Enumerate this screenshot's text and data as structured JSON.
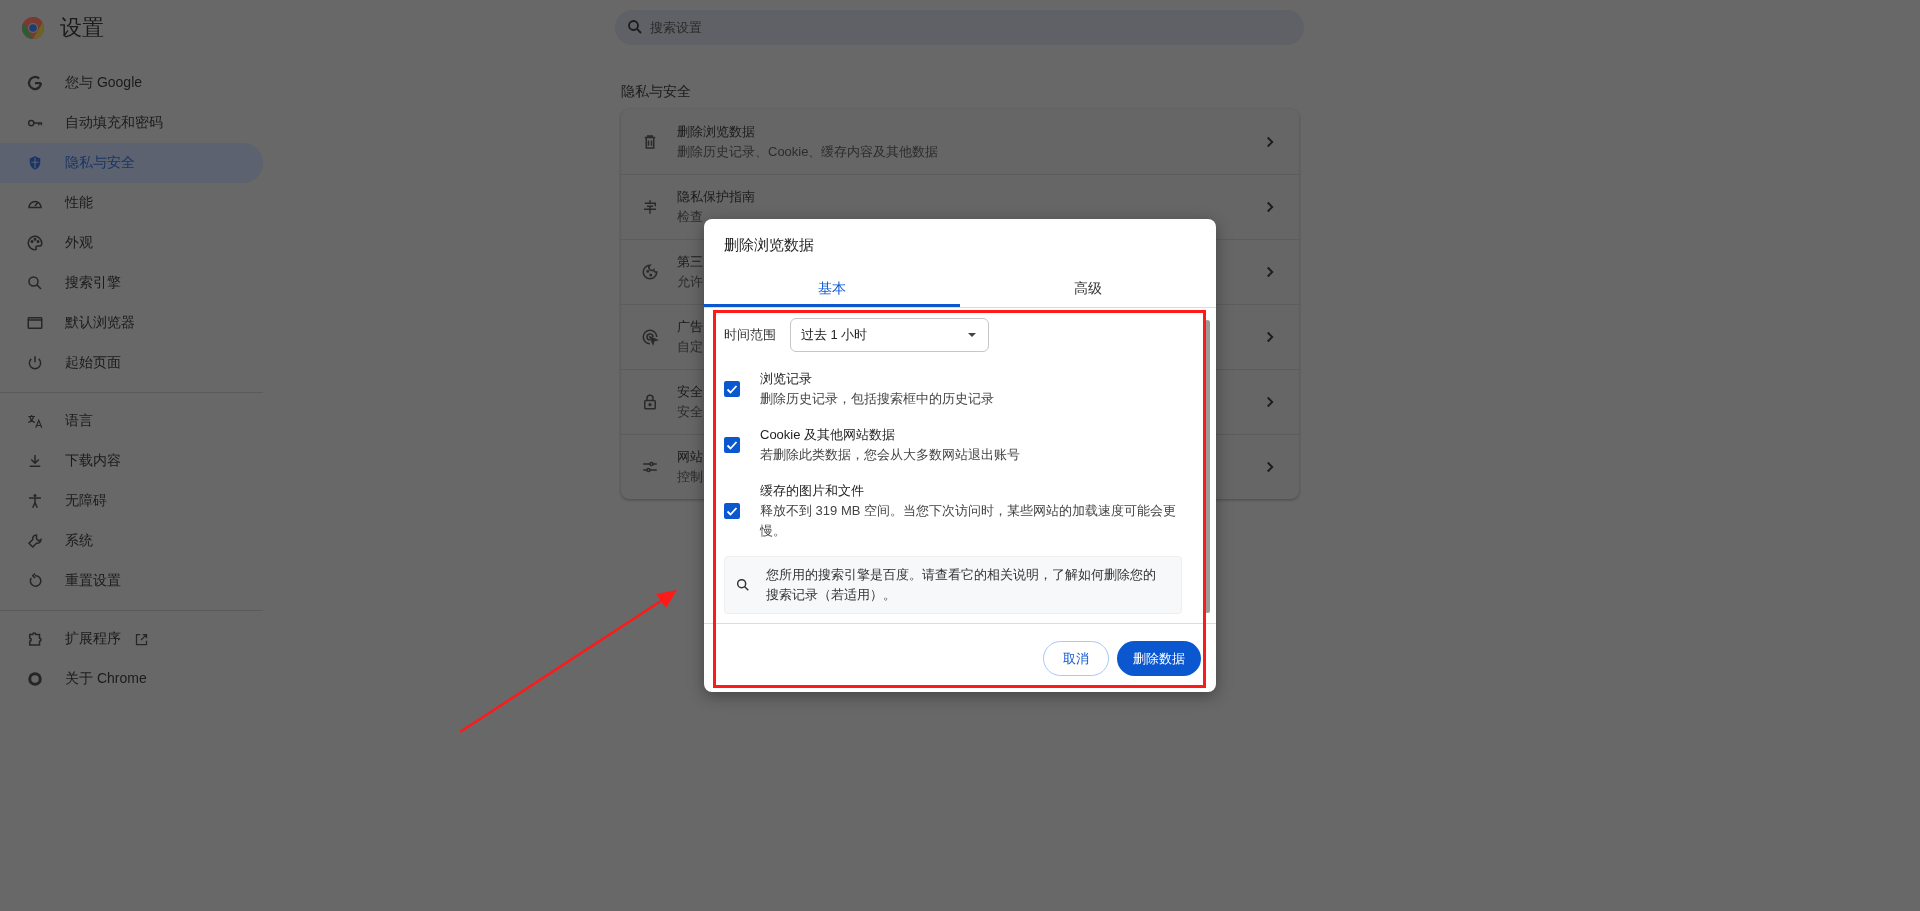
{
  "sidebar": {
    "title": "设置",
    "groups": [
      [
        {
          "label": "您与 Google",
          "selected": false
        },
        {
          "label": "自动填充和密码",
          "selected": false
        },
        {
          "label": "隐私与安全",
          "selected": true
        },
        {
          "label": "性能",
          "selected": false
        },
        {
          "label": "外观",
          "selected": false
        },
        {
          "label": "搜索引擎",
          "selected": false
        },
        {
          "label": "默认浏览器",
          "selected": false
        },
        {
          "label": "起始页面",
          "selected": false
        }
      ],
      [
        {
          "label": "语言",
          "selected": false
        },
        {
          "label": "下载内容",
          "selected": false
        },
        {
          "label": "无障碍",
          "selected": false
        },
        {
          "label": "系统",
          "selected": false
        },
        {
          "label": "重置设置",
          "selected": false
        }
      ],
      [
        {
          "label": "扩展程序",
          "selected": false,
          "external": true
        },
        {
          "label": "关于 Chrome",
          "selected": false
        }
      ]
    ]
  },
  "search": {
    "placeholder": "搜索设置"
  },
  "section": {
    "title": "隐私与安全",
    "rows": [
      {
        "title": "删除浏览数据",
        "subtitle": "删除历史记录、Cookie、缓存内容及其他数据"
      },
      {
        "title": "隐私保护指南",
        "subtitle": "检查"
      },
      {
        "title": "第三",
        "subtitle": "允许"
      },
      {
        "title": "广告",
        "subtitle": "自定"
      },
      {
        "title": "安全",
        "subtitle": "安全"
      },
      {
        "title": "网站",
        "subtitle": "控制"
      }
    ]
  },
  "dialog": {
    "title": "删除浏览数据",
    "tabs": [
      {
        "label": "基本",
        "selected": true
      },
      {
        "label": "高级",
        "selected": false
      }
    ],
    "time_range": {
      "label": "时间范围",
      "value": "过去 1 小时"
    },
    "options": [
      {
        "title": "浏览记录",
        "description": "删除历史记录，包括搜索框中的历史记录",
        "checked": true
      },
      {
        "title": "Cookie 及其他网站数据",
        "description": "若删除此类数据，您会从大多数网站退出账号",
        "checked": true
      },
      {
        "title": "缓存的图片和文件",
        "description": "释放不到 319 MB 空间。当您下次访问时，某些网站的加载速度可能会更慢。",
        "checked": true
      }
    ],
    "notice": "您所用的搜索引擎是百度。请查看它的相关说明，了解如何删除您的搜索记录（若适用）。",
    "buttons": {
      "cancel": "取消",
      "confirm": "删除数据"
    }
  }
}
